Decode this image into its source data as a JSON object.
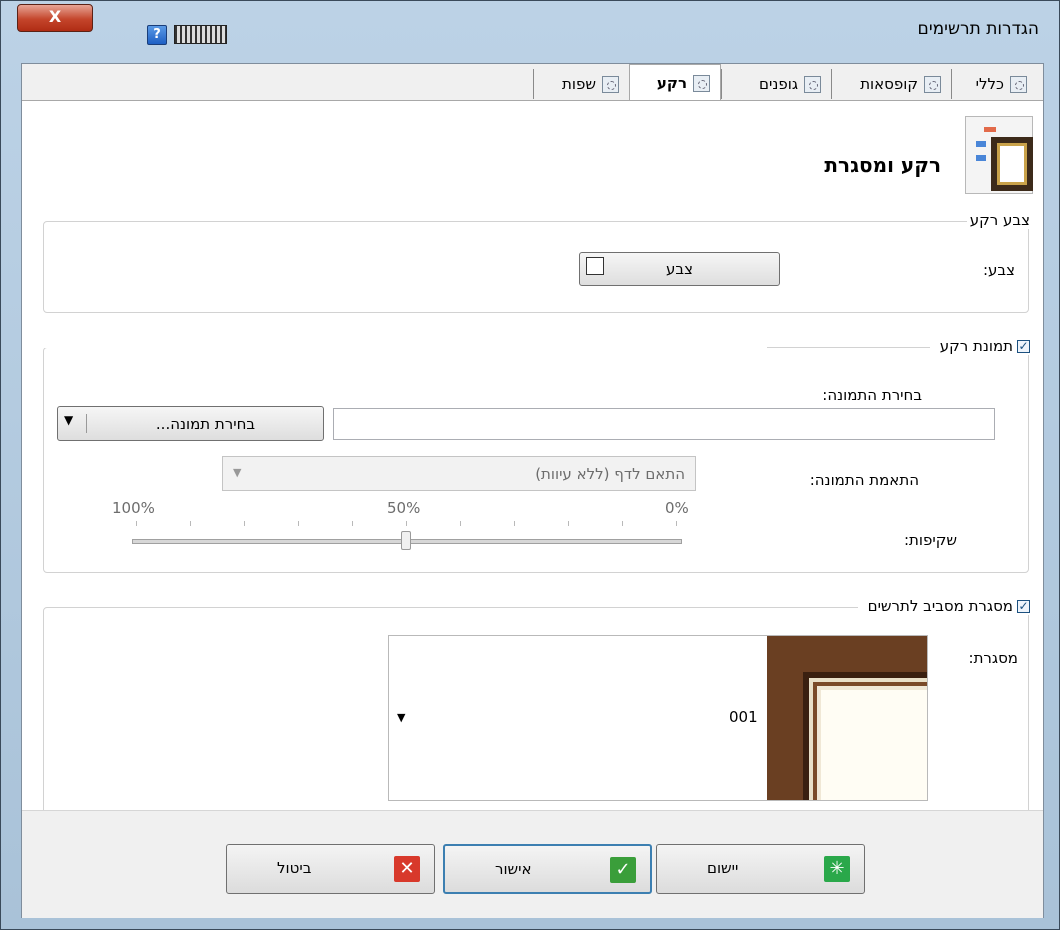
{
  "window": {
    "title": "הגדרות תרשימים",
    "close_label": "X",
    "help_label": "?"
  },
  "tabs": [
    {
      "label": "כללי"
    },
    {
      "label": "קופסאות"
    },
    {
      "label": "גופנים"
    },
    {
      "label": "רקע",
      "selected": true
    },
    {
      "label": "שפות"
    }
  ],
  "header": {
    "title": "רקע ומסגרת"
  },
  "background_color": {
    "group_label": "צבע רקע",
    "color_label": "צבע:",
    "color_button_label": "צבע",
    "current_color": "#ffffff"
  },
  "background_image": {
    "enabled": true,
    "group_label": "תמונת רקע",
    "select_image_label": "בחירת התמונה:",
    "image_path_value": "",
    "select_image_button": "בחירת תמונה...",
    "fit_label": "התאמת התמונה:",
    "fit_value": "התאם לדף (ללא עיוות)",
    "transparency_label": "שקיפות:",
    "transparency_value_percent": 50,
    "scale_labels": {
      "min": "0%",
      "mid": "50%",
      "max": "100%"
    }
  },
  "chart_frame": {
    "enabled": true,
    "group_label": "מסגרת מסביב לתרשים",
    "frame_label": "מסגרת:",
    "frame_value": "001"
  },
  "footer": {
    "apply_label": "יישום",
    "ok_label": "אישור",
    "cancel_label": "ביטול",
    "colors": {
      "apply": "#2aa84a",
      "ok": "#3a9e3a",
      "cancel": "#d8392b"
    }
  }
}
